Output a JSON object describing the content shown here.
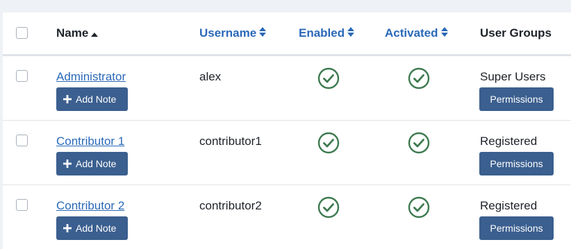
{
  "table": {
    "headers": {
      "name": "Name",
      "username": "Username",
      "enabled": "Enabled",
      "activated": "Activated",
      "user_groups": "User Groups"
    },
    "icons": {
      "sort_ascending": "caret-up-icon",
      "sort_both": "sort-arrows-icon",
      "status_ok": "check-circle-icon",
      "add": "plus-icon"
    },
    "colors": {
      "link": "#2a69b8",
      "button": "#3b5f8f",
      "check": "#3d7a4f"
    },
    "add_note_label": "Add Note",
    "permissions_label": "Permissions",
    "rows": [
      {
        "name": "Administrator",
        "username": "alex",
        "enabled": true,
        "activated": true,
        "user_group": "Super Users"
      },
      {
        "name": "Contributor 1",
        "username": "contributor1",
        "enabled": true,
        "activated": true,
        "user_group": "Registered"
      },
      {
        "name": "Contributor 2",
        "username": "contributor2",
        "enabled": true,
        "activated": true,
        "user_group": "Registered"
      }
    ]
  }
}
